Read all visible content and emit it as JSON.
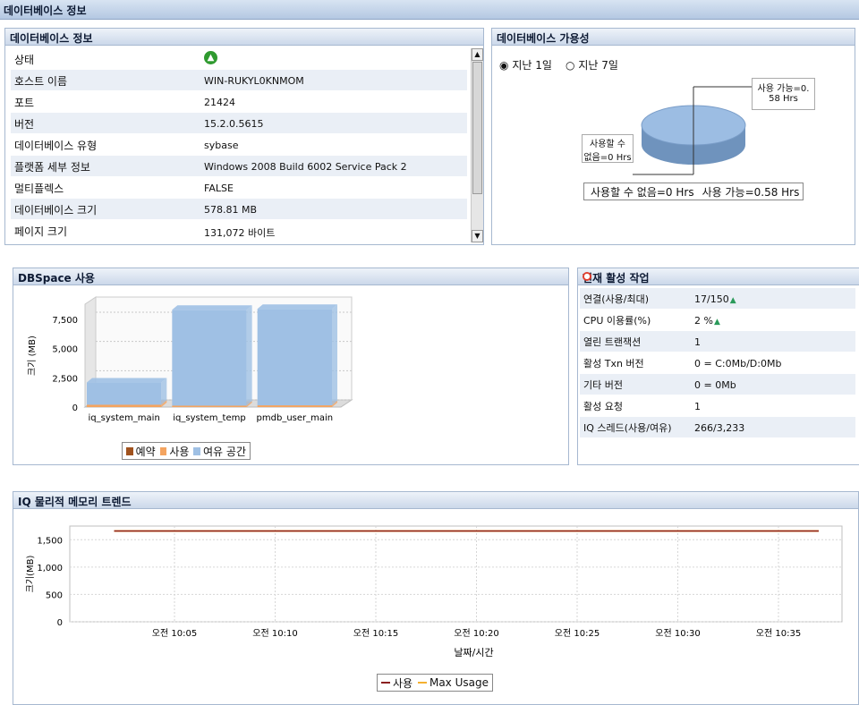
{
  "page_title": "데이터베이스 정보",
  "db_info": {
    "title": "데이터베이스 정보",
    "rows": [
      {
        "label": "상태",
        "value": "",
        "icon": "green-up-arrow-icon"
      },
      {
        "label": "호스트 이름",
        "value": "WIN-RUKYL0KNMOM"
      },
      {
        "label": "포트",
        "value": "21424"
      },
      {
        "label": "버전",
        "value": "15.2.0.5615"
      },
      {
        "label": "데이터베이스 유형",
        "value": "sybase"
      },
      {
        "label": "플랫폼 세부 정보",
        "value": "Windows 2008 Build 6002 Service Pack 2"
      },
      {
        "label": "멀티플렉스",
        "value": "FALSE"
      },
      {
        "label": "데이터베이스 크기",
        "value": "578.81 MB"
      },
      {
        "label": "페이지 크기",
        "value": "131,072 바이트"
      }
    ]
  },
  "availability": {
    "title": "데이터베이스 가용성",
    "radio_1day": "지난 1일",
    "radio_7day": "지난 7일",
    "selected": "지난 1일",
    "callout_available_1": "사용 가능=0.",
    "callout_available_2": "58 Hrs",
    "callout_unavailable_1": "사용할 수",
    "callout_unavailable_2": "없음=0 Hrs",
    "legend_unavailable": "사용할 수 없음=0 Hrs",
    "legend_available": "사용 가능=0.58 Hrs",
    "colors": {
      "unavailable": "#e8a05a",
      "available": "#8fb4dc"
    }
  },
  "dbspace": {
    "title": "DBSpace 사용",
    "legend": {
      "reserved": "예약",
      "used": "사용",
      "free": "여유 공간"
    },
    "colors": {
      "reserved": "#a0521e",
      "used": "#f4a460",
      "free": "#9fc0e4"
    }
  },
  "activity": {
    "title": "현재 활성 작업",
    "close_icon": "close-icon",
    "rows": [
      {
        "label": "연결(사용/최대)",
        "value": "17/150",
        "trend": "up-triangle-icon"
      },
      {
        "label": "CPU 이용률(%)",
        "value": "2 %",
        "trend": "up-triangle-icon"
      },
      {
        "label": "열린 트랜잭션",
        "value": "1"
      },
      {
        "label": "활성 Txn 버전",
        "value": "0 = C:0Mb/D:0Mb"
      },
      {
        "label": "기타 버전",
        "value": "0 = 0Mb"
      },
      {
        "label": "활성 요청",
        "value": "1"
      },
      {
        "label": "IQ 스레드(사용/여유)",
        "value": "266/3,233"
      }
    ]
  },
  "memory": {
    "title": "IQ 물리적 메모리 트렌드",
    "legend": {
      "used": "사용",
      "max": "Max Usage"
    },
    "colors": {
      "used": "#8b2020",
      "max": "#f4b030"
    }
  },
  "chart_data": [
    {
      "type": "bar",
      "title": "",
      "xlabel": "",
      "ylabel": "크기 (MB)",
      "categories": [
        "iq_system_main",
        "iq_system_temp",
        "pmdb_user_main"
      ],
      "y_ticks": [
        "0",
        "2,500",
        "5,000",
        "7,500"
      ],
      "ylim": [
        0,
        8800
      ],
      "stacked": true,
      "series": [
        {
          "name": "예약",
          "values": [
            0,
            0,
            0
          ]
        },
        {
          "name": "사용",
          "values": [
            200,
            120,
            150
          ]
        },
        {
          "name": "여유 공간",
          "values": [
            1900,
            8200,
            8250
          ]
        }
      ],
      "grid": true,
      "legend": "bottom"
    },
    {
      "type": "pie",
      "title": "",
      "labels": [
        "사용할 수 없음",
        "사용 가능"
      ],
      "values": [
        0,
        0.58
      ],
      "legend": "bottom"
    },
    {
      "type": "line",
      "title": "",
      "xlabel": "날짜/시간",
      "ylabel": "크기(MB)",
      "x_ticks": [
        "오전 10:05",
        "오전 10:10",
        "오전 10:15",
        "오전 10:20",
        "오전 10:25",
        "오전 10:30",
        "오전 10:35"
      ],
      "y_ticks": [
        "0",
        "500",
        "1,000",
        "1,500"
      ],
      "ylim": [
        0,
        1750
      ],
      "series": [
        {
          "name": "사용",
          "x_range": [
            "오전 10:02",
            "오전 10:37"
          ],
          "values": [
            1660,
            1660
          ]
        },
        {
          "name": "Max Usage",
          "x_range": [
            "오전 10:02",
            "오전 10:37"
          ],
          "values": [
            1660,
            1660
          ]
        }
      ],
      "grid": true,
      "legend": "bottom"
    }
  ]
}
